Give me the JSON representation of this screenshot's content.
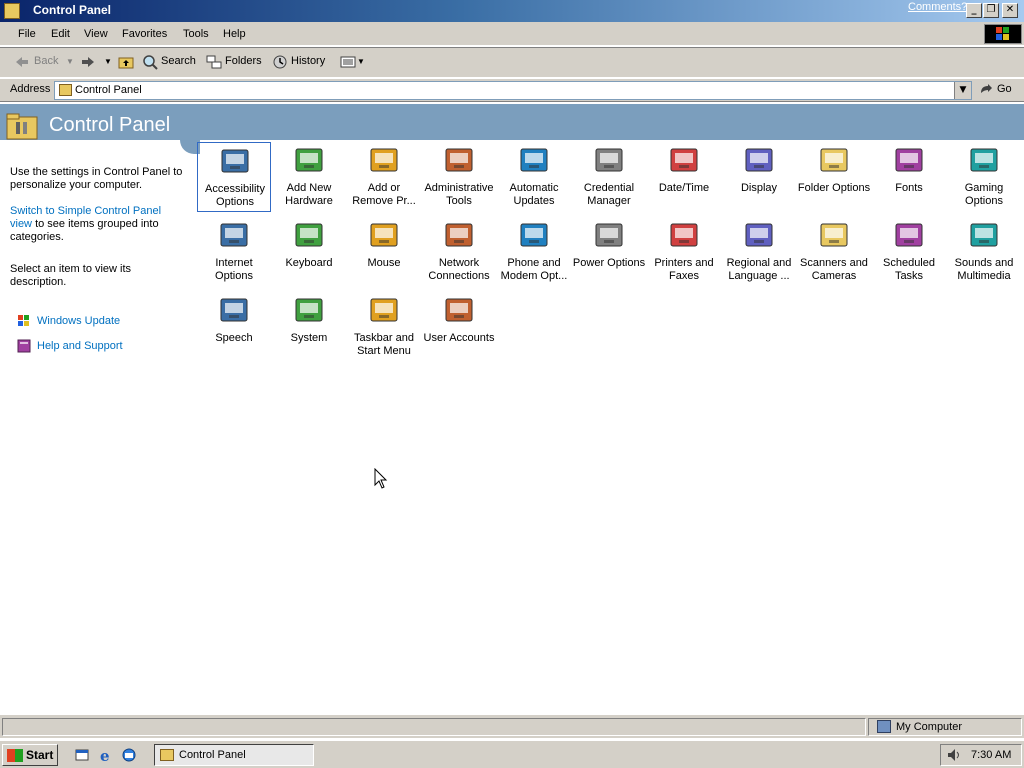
{
  "window": {
    "title": "Control Panel",
    "comments_link": "Comments?",
    "minimize": "_",
    "restore": "❐",
    "close": "✕"
  },
  "menu": [
    "File",
    "Edit",
    "View",
    "Favorites",
    "Tools",
    "Help"
  ],
  "toolbar": {
    "back": "Back",
    "search": "Search",
    "folders": "Folders",
    "history": "History"
  },
  "address": {
    "label": "Address",
    "value": "Control Panel",
    "go": "Go"
  },
  "banner": {
    "title": "Control Panel"
  },
  "left_pane": {
    "intro": "Use the settings in Control Panel to personalize your computer.",
    "switch_link": "Switch to Simple Control Panel view",
    "switch_rest": "to see items grouped into categories.",
    "select_hint": "Select an item to view its description.",
    "links": [
      {
        "label": "Windows Update",
        "icon": "windows-update-icon"
      },
      {
        "label": "Help and Support",
        "icon": "help-book-icon"
      }
    ]
  },
  "items": [
    {
      "label": "Accessibility\nOptions",
      "icon": "accessibility-icon",
      "selected": true
    },
    {
      "label": "Add New\nHardware",
      "icon": "add-hardware-icon"
    },
    {
      "label": "Add or\nRemove Pr...",
      "icon": "add-remove-programs-icon"
    },
    {
      "label": "Administrative\nTools",
      "icon": "administrative-tools-icon"
    },
    {
      "label": "Automatic\nUpdates",
      "icon": "automatic-updates-icon"
    },
    {
      "label": "Credential\nManager",
      "icon": "credential-manager-icon"
    },
    {
      "label": "Date/Time",
      "icon": "date-time-icon"
    },
    {
      "label": "Display",
      "icon": "display-icon"
    },
    {
      "label": "Folder Options",
      "icon": "folder-options-icon"
    },
    {
      "label": "Fonts",
      "icon": "fonts-icon"
    },
    {
      "label": "Gaming\nOptions",
      "icon": "gaming-options-icon"
    },
    {
      "label": "Internet\nOptions",
      "icon": "internet-options-icon"
    },
    {
      "label": "Keyboard",
      "icon": "keyboard-icon"
    },
    {
      "label": "Mouse",
      "icon": "mouse-icon"
    },
    {
      "label": "Network\nConnections",
      "icon": "network-connections-icon"
    },
    {
      "label": "Phone and\nModem Opt...",
      "icon": "phone-modem-icon"
    },
    {
      "label": "Power Options",
      "icon": "power-options-icon"
    },
    {
      "label": "Printers and\nFaxes",
      "icon": "printers-faxes-icon"
    },
    {
      "label": "Regional and\nLanguage ...",
      "icon": "regional-language-icon"
    },
    {
      "label": "Scanners and\nCameras",
      "icon": "scanners-cameras-icon"
    },
    {
      "label": "Scheduled\nTasks",
      "icon": "scheduled-tasks-icon"
    },
    {
      "label": "Sounds and\nMultimedia",
      "icon": "sounds-multimedia-icon"
    },
    {
      "label": "Speech",
      "icon": "speech-icon"
    },
    {
      "label": "System",
      "icon": "system-icon"
    },
    {
      "label": "Taskbar and\nStart Menu",
      "icon": "taskbar-start-menu-icon"
    },
    {
      "label": "User Accounts",
      "icon": "user-accounts-icon"
    }
  ],
  "status": {
    "zone": "My Computer"
  },
  "taskbar": {
    "start": "Start",
    "task": "Control Panel",
    "time": "7:30 AM"
  }
}
